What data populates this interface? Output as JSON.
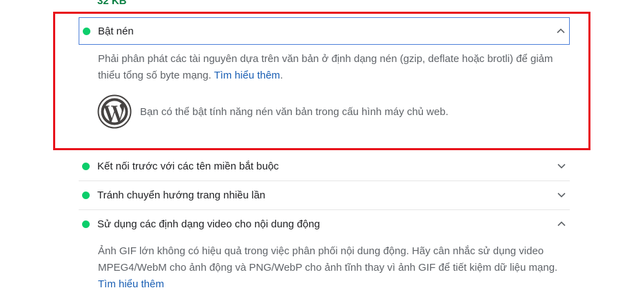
{
  "top_savings": "32 KB",
  "colors": {
    "pass_dot": "#0cce6b",
    "link": "#1a5fb4",
    "highlight": "#e8101a"
  },
  "audits": [
    {
      "title": "Bật nén",
      "expanded": true,
      "description": "Phải phân phát các tài nguyên dựa trên văn bản ở định dạng nén (gzip, deflate hoặc brotli) để giảm thiểu tổng số byte mạng.",
      "link": "Tìm hiểu thêm",
      "link_suffix": ".",
      "stack_icon": "wordpress-icon",
      "stack_note": "Bạn có thể bật tính năng nén văn bản trong cấu hình máy chủ web."
    },
    {
      "title": "Kết nối trước với các tên miền bắt buộc",
      "expanded": false
    },
    {
      "title": "Tránh chuyển hướng trang nhiều lần",
      "expanded": false
    },
    {
      "title": "Sử dụng các định dạng video cho nội dung động",
      "expanded": true,
      "description": "Ảnh GIF lớn không có hiệu quả trong việc phân phối nội dung động. Hãy cân nhắc sử dụng video MPEG4/WebM cho ảnh động và PNG/WebP cho ảnh tĩnh thay vì ảnh GIF để tiết kiệm dữ liệu mạng.",
      "link": "Tìm hiểu thêm"
    }
  ]
}
